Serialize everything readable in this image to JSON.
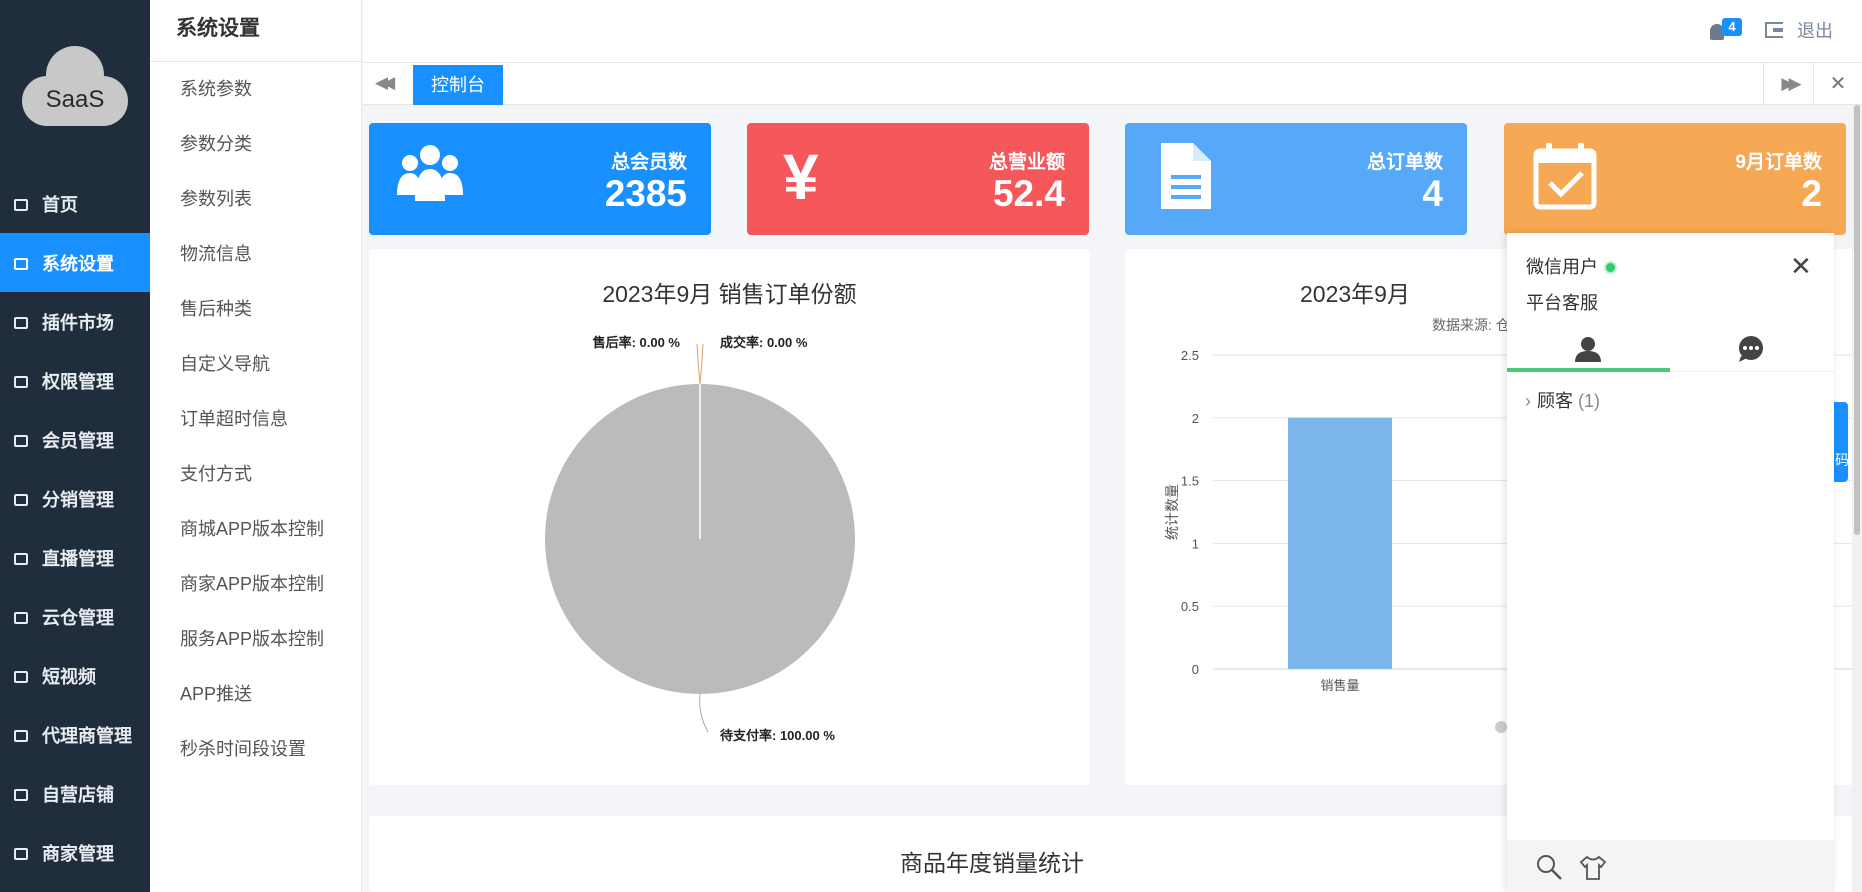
{
  "logo": {
    "text": "SaaS"
  },
  "nav": {
    "items": [
      {
        "label": "首页",
        "icon": "home-icon"
      },
      {
        "label": "系统设置",
        "icon": "gear-icon",
        "active": true
      },
      {
        "label": "插件市场",
        "icon": "plugin-icon"
      },
      {
        "label": "权限管理",
        "icon": "sitemap-icon"
      },
      {
        "label": "会员管理",
        "icon": "users-icon"
      },
      {
        "label": "分销管理",
        "icon": "users-icon"
      },
      {
        "label": "直播管理",
        "icon": "video-icon"
      },
      {
        "label": "云仓管理",
        "icon": "home-icon"
      },
      {
        "label": "短视频",
        "icon": "file-video-icon"
      },
      {
        "label": "代理商管理",
        "icon": "cubes-icon"
      },
      {
        "label": "自营店铺",
        "icon": "balance-icon"
      },
      {
        "label": "商家管理",
        "icon": "bank-icon"
      }
    ]
  },
  "submenu": {
    "title": "系统设置",
    "items": [
      "系统参数",
      "参数分类",
      "参数列表",
      "物流信息",
      "售后种类",
      "自定义导航",
      "订单超时信息",
      "支付方式",
      "商城APP版本控制",
      "商家APP版本控制",
      "服务APP版本控制",
      "APP推送",
      "秒杀时间段设置"
    ]
  },
  "header": {
    "notification_count": "4",
    "logout_label": "退出"
  },
  "tabs": {
    "active_label": "控制台"
  },
  "stats": [
    {
      "label": "总会员数",
      "value": "2385",
      "color": "#1890ff",
      "icon": "users-icon"
    },
    {
      "label": "总营业额",
      "value": "52.4",
      "color": "#f5575b",
      "icon": "yen-icon"
    },
    {
      "label": "总订单数",
      "value": "4",
      "color": "#55a9f8",
      "icon": "document-icon"
    },
    {
      "label": "9月订单数",
      "value": "2",
      "color": "#f6a855",
      "icon": "calendar-check-icon"
    }
  ],
  "pie_panel": {
    "title": "2023年9月 销售订单份额"
  },
  "bar_panel": {
    "title": "2023年9月",
    "source_label": "数据来源: 仓"
  },
  "bottom_panel": {
    "title": "商品年度销量统计"
  },
  "chart_data": [
    {
      "type": "pie",
      "title": "2023年9月 销售订单份额",
      "slices": [
        {
          "name": "售后率",
          "value": 0,
          "label": "售后率: 0.00 %"
        },
        {
          "name": "成交率",
          "value": 0,
          "label": "成交率: 0.00 %"
        },
        {
          "name": "待支付率",
          "value": 100,
          "label": "待支付率: 100.00 %"
        }
      ],
      "color": "#bbbbbb"
    },
    {
      "type": "bar",
      "title": "2023年9月",
      "categories": [
        "销售量"
      ],
      "values": [
        2
      ],
      "ylabel": "统计数量",
      "ylim": [
        0,
        2.5
      ],
      "yticks": [
        "0",
        "0.5",
        "1",
        "1.5",
        "2",
        "2.5"
      ],
      "color": "#7cb5ec",
      "grid": true
    }
  ],
  "chat": {
    "user_name": "微信用户",
    "service_name": "平台客服",
    "group_label": "顾客",
    "group_count": "(1)"
  },
  "side_tab": {
    "label": "码"
  }
}
